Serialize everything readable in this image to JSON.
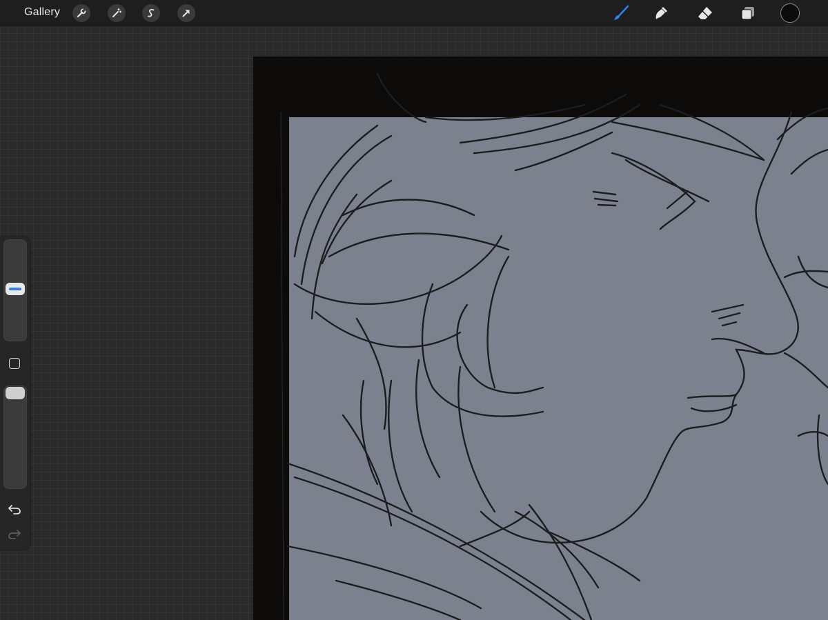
{
  "topbar": {
    "gallery_label": "Gallery",
    "left_tools": [
      "wrench-icon",
      "magic-wand-icon",
      "selection-s-icon",
      "transform-arrow-icon"
    ],
    "right_tools": [
      "brush-icon",
      "smudge-icon",
      "eraser-icon",
      "layers-icon",
      "color-swatch"
    ],
    "active_tool": "brush-icon",
    "accent_color": "#2f80ed",
    "current_color": "#0c0a0a"
  },
  "sidebar": {
    "brush_size_level": 0.35,
    "brush_opacity_level": 1.0,
    "controls": [
      "modify-button-icon",
      "undo-icon",
      "redo-icon"
    ]
  },
  "canvas": {
    "artboard_color": "#7c828d",
    "surround_color": "#0d0a0a",
    "content": "sketch-drawing"
  }
}
